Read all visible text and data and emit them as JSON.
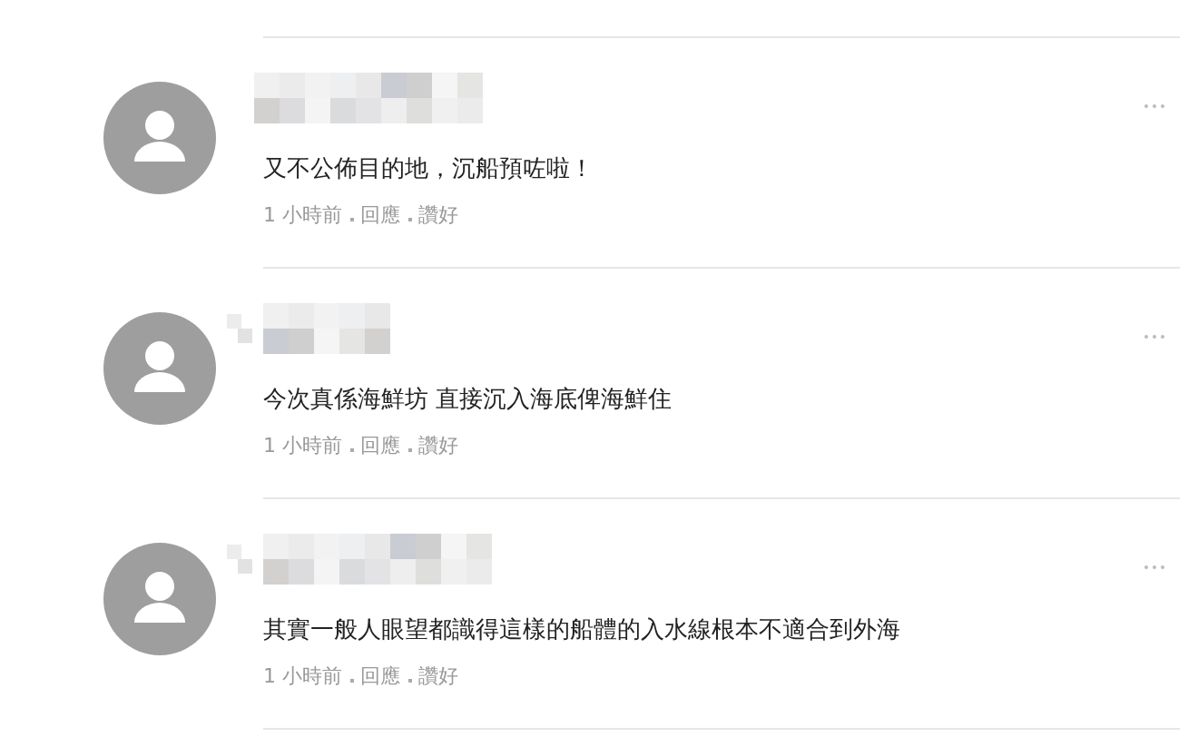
{
  "comments": [
    {
      "text": "又不公佈目的地，沉船預咗啦！",
      "meta": [
        "1 小時前",
        "回應",
        "讚好"
      ]
    },
    {
      "text": "今次真係海鮮坊 直接沉入海底俾海鮮住",
      "meta": [
        "1 小時前",
        "回應",
        "讚好"
      ]
    },
    {
      "text": "其實一般人眼望都識得這樣的船體的入水線根本不適合到外海",
      "meta": [
        "1 小時前",
        "回應",
        "讚好"
      ]
    }
  ]
}
